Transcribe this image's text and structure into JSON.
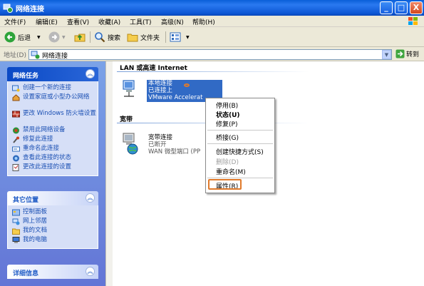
{
  "window": {
    "title": "网络连接",
    "min": "_",
    "max": "□",
    "close": "X"
  },
  "menubar": [
    "文件(F)",
    "编辑(E)",
    "查看(V)",
    "收藏(A)",
    "工具(T)",
    "高级(N)",
    "帮助(H)"
  ],
  "toolbar": {
    "back": "后退",
    "search": "搜索",
    "folders": "文件夹"
  },
  "address": {
    "label": "地址(D)",
    "value": "网络连接",
    "go": "转到"
  },
  "network_tasks": {
    "title": "网络任务",
    "items": [
      "创建一个新的连接",
      "设置家庭或小型办公网络",
      "更改 Windows 防火墙设置",
      "禁用此网络设备",
      "修复此连接",
      "重命名此连接",
      "查看此连接的状态",
      "更改此连接的设置"
    ]
  },
  "other_places": {
    "title": "其它位置",
    "items": [
      "控制面板",
      "网上邻居",
      "我的文档",
      "我的电脑"
    ]
  },
  "details": {
    "title": "详细信息"
  },
  "groups": {
    "lan": "LAN 或高速 Internet",
    "broadband": "宽带"
  },
  "lan_conn": {
    "name": "本地连接",
    "status": "已连接上",
    "device": "VMware Accelerat"
  },
  "bb_conn": {
    "name": "宽带连接",
    "status": "已断开",
    "device": "WAN 微型端口 (PP"
  },
  "context_menu": {
    "items": [
      "停用(B)",
      "状态(U)",
      "修复(P)",
      "桥接(G)",
      "创建快捷方式(S)",
      "删除(D)",
      "重命名(M)",
      "属性(R)"
    ]
  },
  "colors": {
    "title_bar": "#0a5fd8",
    "task_pane": "#7ba2e7",
    "highlight": "#e07a2b",
    "selection": "#316ac5"
  }
}
